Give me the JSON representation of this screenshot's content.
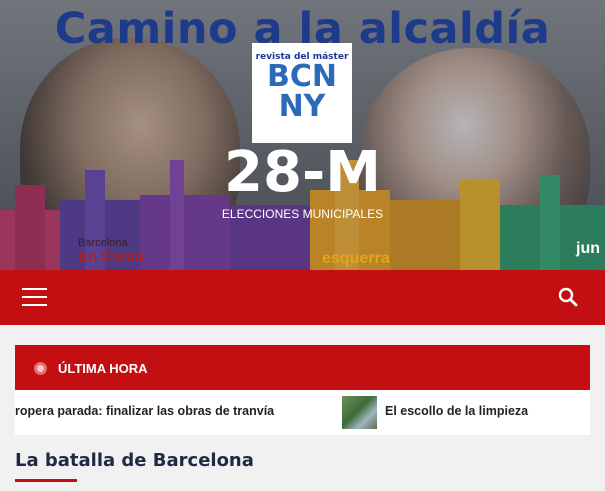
{
  "hero": {
    "headline": "Camino a la alcaldía",
    "party_left_top": "Barcelona",
    "party_left_bottom": "En Comú",
    "party_right": "esquerra",
    "party_far_right": "jun"
  },
  "logo": {
    "line1": "revista del máster",
    "line2": "BCN",
    "line3": "NY"
  },
  "site": {
    "title": "28-M",
    "description": "ELECCIONES MUNICIPALES"
  },
  "nav": {
    "menu_icon": "hamburger-icon",
    "search_icon": "search-icon"
  },
  "ticker": {
    "title": "ÚLTIMA HORA",
    "items": [
      {
        "text": "ropera parada: finalizar las obras de tranvía"
      },
      {
        "text": "El escollo de la limpieza"
      }
    ]
  },
  "section": {
    "title": "La batalla de Barcelona"
  },
  "colors": {
    "brand_red": "#c40f12",
    "headline_blue": "#1e3a8a"
  }
}
